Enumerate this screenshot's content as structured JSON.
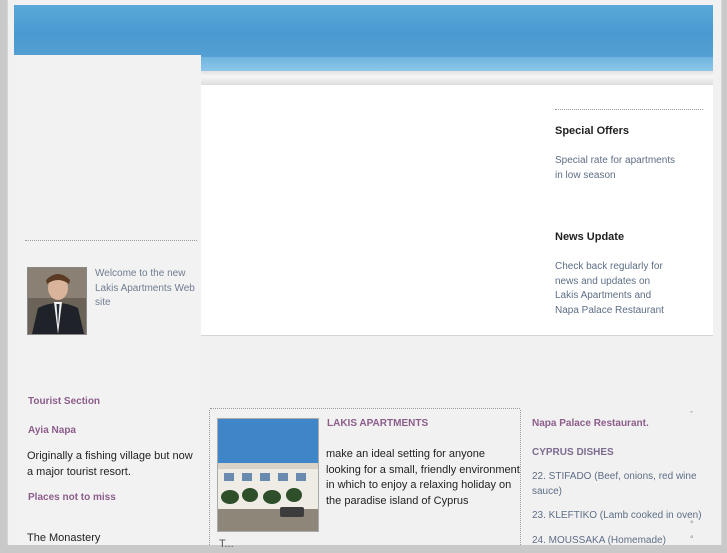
{
  "left": {
    "welcome_text": "Welcome to the new Lakis Apartments Web site",
    "tourist_section": "Tourist Section",
    "ayia_napa_title": "Ayia Napa",
    "ayia_napa_text": "Originally a fishing village but now a major tourist resort.",
    "places_not_to_miss": "Places not to miss",
    "first_place": "The Monastery"
  },
  "right_panel": {
    "special_offers_title": "Special Offers",
    "special_offers_text": "Special rate for apartments in low season",
    "news_update_title": "News Update",
    "news_update_text": "Check back regularly for news and updates on Lakis Apartments and Napa Palace Restaurant"
  },
  "main": {
    "lakis_title": "LAKIS APARTMENTS",
    "lakis_text": "make an ideal setting for anyone looking for a small, friendly environment in which to enjoy a relaxing holiday on the paradise island of Cyprus",
    "photo_caption_partial": "T..."
  },
  "restaurant": {
    "title": "Napa Palace Restaurant.",
    "dishes_heading": "CYPRUS DISHES",
    "dishes": [
      "22. STIFADO (Beef, onions, red wine sauce)",
      "23. KLEFTIKO (Lamb cooked in oven)",
      "24. MOUSSAKA (Homemade)"
    ]
  },
  "colors": {
    "header_blue": "#4a9ad0",
    "link_purple": "#8c5d8b",
    "muted_blue_text": "#5e6e86"
  }
}
